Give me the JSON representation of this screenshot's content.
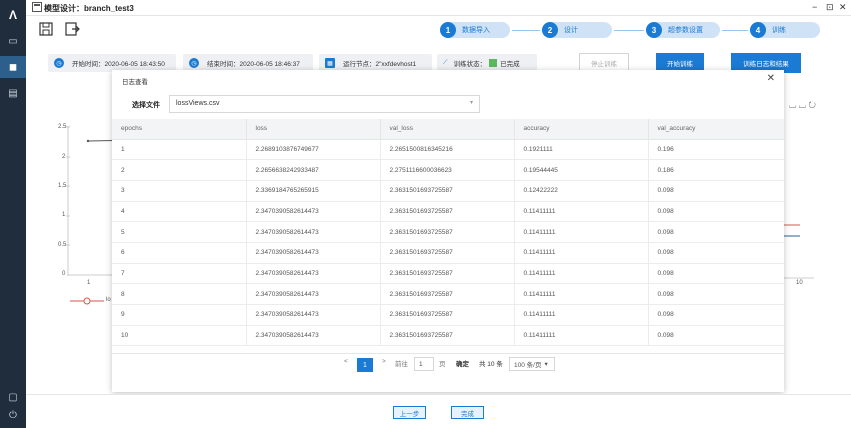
{
  "window": {
    "title": "模型设计：branch_test3",
    "minimize": "−",
    "maximize": "⊡",
    "close": "✕"
  },
  "steps": [
    {
      "num": "1",
      "label": "数据导入"
    },
    {
      "num": "2",
      "label": "设计"
    },
    {
      "num": "3",
      "label": "超参数设置"
    },
    {
      "num": "4",
      "label": "训练"
    }
  ],
  "info": {
    "start": "开始时间：2020-06-05 18:43:50",
    "end": "结束时间：2020-06-05 18:46:37",
    "node": "运行节点：2\"xxfdevhost1",
    "status_label": "训练状态：",
    "status_value": "已完成",
    "status_color": "#5cb85c"
  },
  "buttons": {
    "stop": "停止训练",
    "start": "开始训练",
    "log": "训练日志和结果",
    "prev": "上一步",
    "done": "完成"
  },
  "chart_bg": {
    "yticks": [
      "2.5",
      "2",
      "1.5",
      "1",
      "0.5",
      "0"
    ],
    "xtick_left": "1",
    "xtick_right": "10",
    "legend_label": "lo"
  },
  "dialog": {
    "title": "日志查看",
    "file_label": "选择文件",
    "file_value": "lossViews.csv",
    "columns": [
      "epochs",
      "loss",
      "val_loss",
      "accuracy",
      "val_accuracy"
    ],
    "rows": [
      [
        "1",
        "2.2689103876749677",
        "2.2651500816345216",
        "0.1921111",
        "0.196"
      ],
      [
        "2",
        "2.2656638242933487",
        "2.2751116600036623",
        "0.19544445",
        "0.186"
      ],
      [
        "3",
        "2.3369184765265915",
        "2.3631501693725587",
        "0.12422222",
        "0.098"
      ],
      [
        "4",
        "2.3470390582614473",
        "2.3631501693725587",
        "0.11411111",
        "0.098"
      ],
      [
        "5",
        "2.3470390582614473",
        "2.3631501693725587",
        "0.11411111",
        "0.098"
      ],
      [
        "6",
        "2.3470390582614473",
        "2.3631501693725587",
        "0.11411111",
        "0.098"
      ],
      [
        "7",
        "2.3470390582614473",
        "2.3631501693725587",
        "0.11411111",
        "0.098"
      ],
      [
        "8",
        "2.3470390582614473",
        "2.3631501693725587",
        "0.11411111",
        "0.098"
      ],
      [
        "9",
        "2.3470390582614473",
        "2.3631501693725587",
        "0.11411111",
        "0.098"
      ],
      [
        "10",
        "2.3470390582614473",
        "2.3631501693725587",
        "0.11411111",
        "0.098"
      ]
    ],
    "pager": {
      "prev": "<",
      "current": "1",
      "next": ">",
      "goto": "前往",
      "goto_value": "1",
      "page_suffix": "页",
      "confirm": "确定",
      "total": "共 10 条",
      "page_size": "100 条/页"
    }
  }
}
